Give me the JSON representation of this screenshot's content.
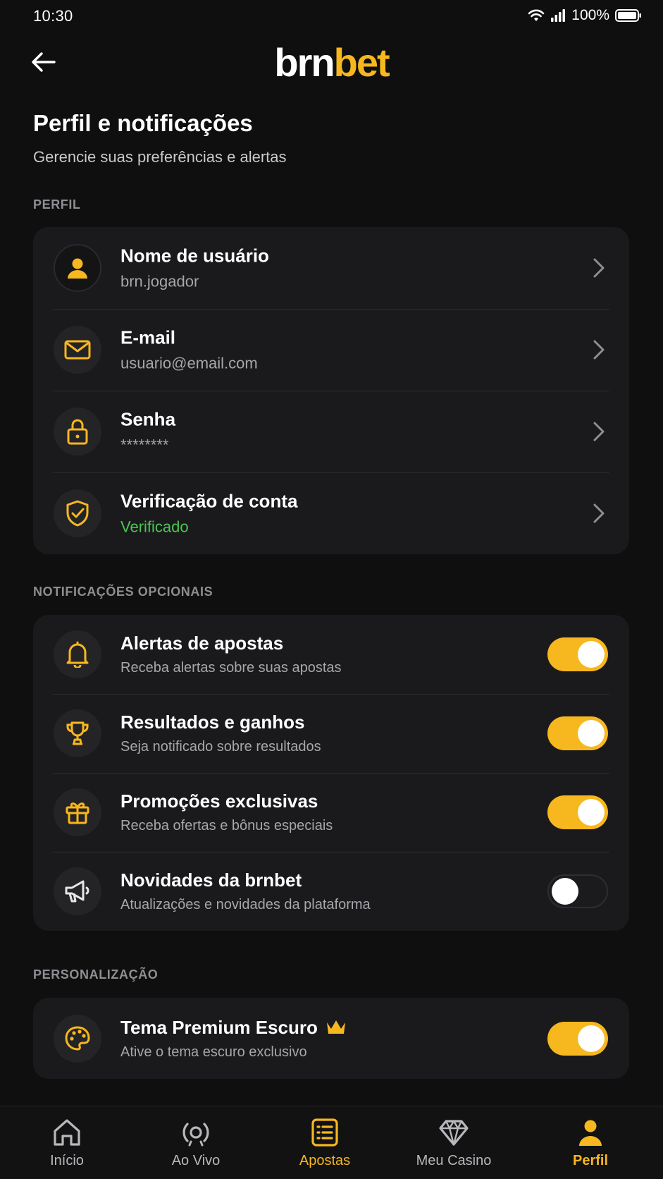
{
  "status": {
    "time": "10:30",
    "battery": "100%"
  },
  "header": {
    "logo_part1": "brn",
    "logo_part2": "bet"
  },
  "page": {
    "title": "Perfil e notificações",
    "subtitle": "Gerencie suas preferências e alertas"
  },
  "sections": {
    "profile_label": "PERFIL",
    "notifications_label": "NOTIFICAÇÕES OPCIONAIS",
    "personalization_label": "PERSONALIZAÇÃO"
  },
  "profile": [
    {
      "title": "Nome de usuário",
      "value": "brn.jogador",
      "icon": "user-icon"
    },
    {
      "title": "E-mail",
      "value": "usuario@email.com",
      "icon": "mail-icon"
    },
    {
      "title": "Senha",
      "value": "********",
      "icon": "lock-icon"
    },
    {
      "title": "Verificação de conta",
      "value": "Verificado",
      "icon": "shield-check-icon"
    }
  ],
  "notifications": [
    {
      "title": "Alertas de apostas",
      "desc": "Receba alertas sobre suas apostas",
      "icon": "bell-icon",
      "enabled": true
    },
    {
      "title": "Resultados e ganhos",
      "desc": "Seja notificado sobre resultados",
      "icon": "trophy-icon",
      "enabled": true
    },
    {
      "title": "Promoções exclusivas",
      "desc": "Receba ofertas e bônus especiais",
      "icon": "gift-icon",
      "enabled": true
    },
    {
      "title": "Novidades da brnbet",
      "desc": "Atualizações e novidades da plataforma",
      "icon": "megaphone-icon",
      "enabled": false
    }
  ],
  "personalization": [
    {
      "title": "Tema Premium Escuro",
      "desc": "Ative o tema escuro exclusivo",
      "icon": "palette-icon",
      "badge": "crown-icon",
      "enabled": true
    }
  ],
  "nav": [
    {
      "label": "Início",
      "icon": "home-icon",
      "active": false
    },
    {
      "label": "Ao Vivo",
      "icon": "live-icon",
      "active": false
    },
    {
      "label": "Apostas",
      "icon": "bets-icon",
      "active": true
    },
    {
      "label": "Meu Casino",
      "icon": "diamond-icon",
      "active": false
    },
    {
      "label": "Perfil",
      "icon": "profile-icon",
      "active": true
    }
  ],
  "colors": {
    "accent": "#f7b71e",
    "verified": "#4cc552",
    "background": "#0f0f10",
    "card": "#1a1a1c"
  }
}
